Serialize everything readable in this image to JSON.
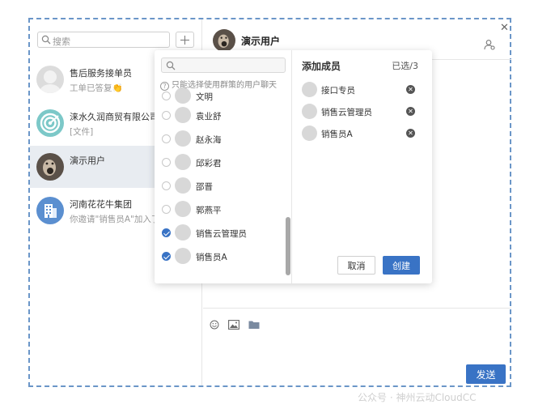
{
  "sidebar": {
    "search_placeholder": "搜索",
    "conversations": [
      {
        "name": "售后服务接单员",
        "message": "工单已答复👏",
        "avatar": "default-avatar"
      },
      {
        "name": "涞水久润商贸有限公司-",
        "message": "[文件]",
        "avatar": "target-logo"
      },
      {
        "name": "演示用户",
        "message": "",
        "avatar": "user-photo"
      },
      {
        "name": "河南花花牛集团",
        "message": "你邀请\"销售员A\"加入了",
        "avatar": "building-icon"
      }
    ]
  },
  "chat": {
    "title": "演示用户",
    "send_label": "发送",
    "tools": [
      "emoji-icon",
      "image-icon",
      "folder-icon"
    ]
  },
  "modal": {
    "search_value": "",
    "hint": "只能选择使用群策的用户聊天",
    "members": [
      {
        "name": "文明",
        "checked": false
      },
      {
        "name": "袁业舒",
        "checked": false
      },
      {
        "name": "赵永海",
        "checked": false
      },
      {
        "name": "邱彩君",
        "checked": false
      },
      {
        "name": "邵晋",
        "checked": false
      },
      {
        "name": "郭燕平",
        "checked": false
      },
      {
        "name": "销售云管理员",
        "checked": true
      },
      {
        "name": "销售员A",
        "checked": true
      }
    ],
    "selected_title": "添加成员",
    "selected_count": "已选/3",
    "selected": [
      "接口专员",
      "销售云管理员",
      "销售员A"
    ],
    "cancel_label": "取消",
    "create_label": "创建"
  },
  "watermark": "公众号 · 神州云动CloudCC",
  "colors": {
    "accent": "#3973c5",
    "frame_border": "#6b96c8",
    "active_row": "#e8ecf1"
  }
}
